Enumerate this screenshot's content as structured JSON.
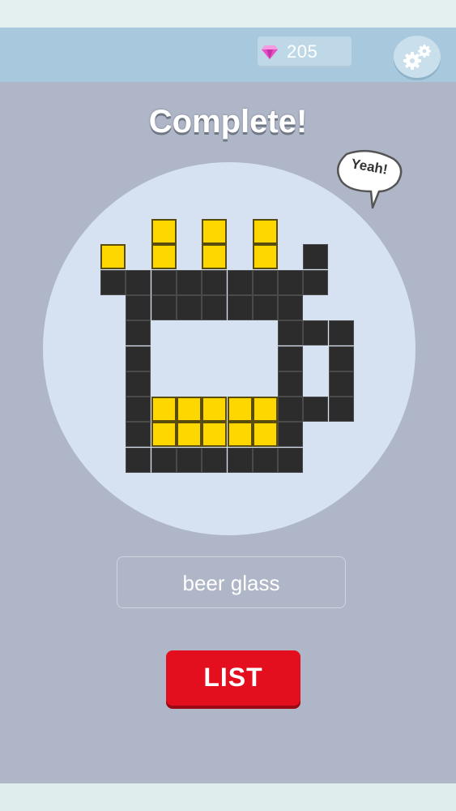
{
  "header": {
    "gem_count": "205"
  },
  "result": {
    "title": "Complete!",
    "bubble_text": "Yeah!",
    "answer": "beer glass"
  },
  "buttons": {
    "list_label": "LIST"
  },
  "colors": {
    "filled": "#2c2c2c",
    "highlight": "#ffd700",
    "button": "#e30f1e"
  },
  "icons": {
    "gem": "gem-icon",
    "settings": "gears-icon"
  },
  "puzzle": {
    "name": "beer glass",
    "legend": {
      ".": "empty",
      "K": "black",
      "Y": "yellow"
    },
    "rows": [
      "..Y.Y.Y...",
      "Y.Y.Y.Y.K.",
      "KKKKKKKKK.",
      ".KKKKKKK..",
      ".K.....KKK",
      ".K.....K.K",
      ".K.....K.K",
      ".KYYYYYKKK",
      ".KYYYYYK..",
      ".KKKKKKK.."
    ]
  }
}
